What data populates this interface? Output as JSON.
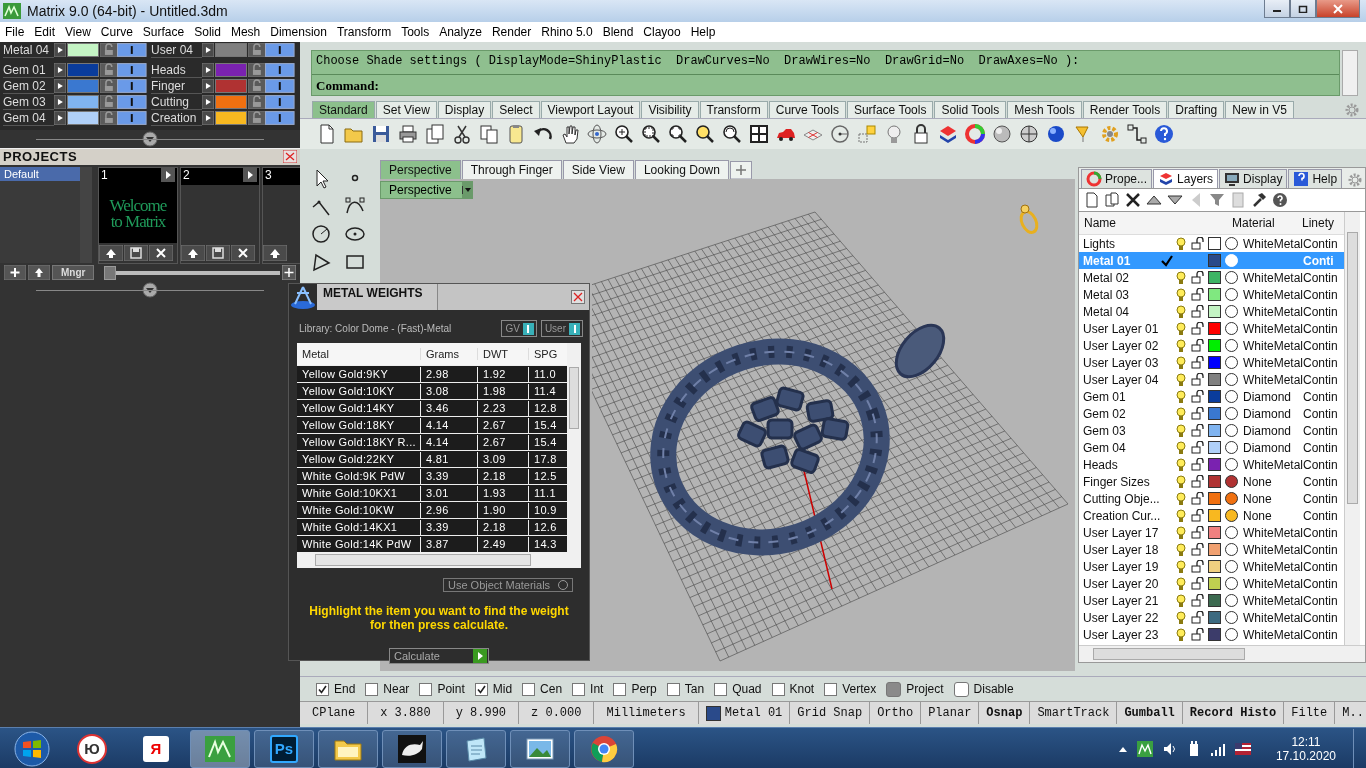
{
  "window": {
    "title": "Matrix 9.0 (64-bit) - Untitled.3dm"
  },
  "menu": [
    "File",
    "Edit",
    "View",
    "Curve",
    "Surface",
    "Solid",
    "Mesh",
    "Dimension",
    "Transform",
    "Tools",
    "Analyze",
    "Render",
    "Rhino 5.0",
    "Blend",
    "Clayoo",
    "Help"
  ],
  "layer_swatches": [
    {
      "items": [
        {
          "name": "Metal 04",
          "color": "#c4f4c4"
        },
        {
          "name": "User 04",
          "color": "#7f7f7f"
        }
      ]
    },
    {
      "items": [
        {
          "name": "Gem 01",
          "color": "#0a3c9c"
        },
        {
          "name": "Heads",
          "color": "#7a22b0"
        },
        {
          "name": "Gem 02",
          "color": "#3a78d0"
        },
        {
          "name": "Finger",
          "color": "#b03232"
        },
        {
          "name": "Gem 03",
          "color": "#80b4f0"
        },
        {
          "name": "Cutting",
          "color": "#f07010"
        },
        {
          "name": "Gem 04",
          "color": "#b0d0f8"
        },
        {
          "name": "Creation",
          "color": "#f8b820"
        }
      ]
    }
  ],
  "projects": {
    "title": "PROJECTS",
    "list": [
      {
        "label": "Default",
        "selected": true
      }
    ],
    "slots": [
      {
        "number": "1",
        "caption": "Welcome to Matrix"
      },
      {
        "number": "2"
      },
      {
        "number": "3"
      }
    ],
    "manager_button": "Mngr",
    "slider": {
      "level": 0
    }
  },
  "command": {
    "history": "Choose Shade settings ( DisplayMode=ShinyPlastic  DrawCurves=No  DrawWires=No  DrawGrid=No  DrawAxes=No ):",
    "prompt": "Command:"
  },
  "toolbar_tabs": [
    {
      "label": "Standard",
      "selected": true
    },
    {
      "label": "Set View",
      "selected": false
    },
    {
      "label": "Display",
      "selected": false
    },
    {
      "label": "Select",
      "selected": false
    },
    {
      "label": "Viewport Layout",
      "selected": false
    },
    {
      "label": "Visibility",
      "selected": false
    },
    {
      "label": "Transform",
      "selected": false
    },
    {
      "label": "Curve Tools",
      "selected": false
    },
    {
      "label": "Surface Tools",
      "selected": false
    },
    {
      "label": "Solid Tools",
      "selected": false
    },
    {
      "label": "Mesh Tools",
      "selected": false
    },
    {
      "label": "Render Tools",
      "selected": false
    },
    {
      "label": "Drafting",
      "selected": false
    },
    {
      "label": "New in V5",
      "selected": false
    }
  ],
  "viewport": {
    "tabs": [
      {
        "label": "Perspective",
        "selected": true
      },
      {
        "label": "Through Finger",
        "selected": false
      },
      {
        "label": "Side View",
        "selected": false
      },
      {
        "label": "Looking Down",
        "selected": false
      }
    ],
    "label": "Perspective"
  },
  "metal_weights": {
    "title": "METAL WEIGHTS",
    "library": "Library: Color Dome - (Fast)-Metal",
    "toggles": [
      {
        "label": "GV",
        "on": true
      },
      {
        "label": "User",
        "on": true
      }
    ],
    "columns": [
      "Metal",
      "Grams",
      "DWT",
      "SPG"
    ],
    "rows": [
      [
        "Yellow Gold:9KY",
        "2.98",
        "1.92",
        "11.0"
      ],
      [
        "Yellow Gold:10KY",
        "3.08",
        "1.98",
        "11.4"
      ],
      [
        "Yellow Gold:14KY",
        "3.46",
        "2.23",
        "12.8"
      ],
      [
        "Yellow Gold:18KY",
        "4.14",
        "2.67",
        "15.4"
      ],
      [
        "Yellow Gold:18KY R...",
        "4.14",
        "2.67",
        "15.4"
      ],
      [
        "Yellow Gold:22KY",
        "4.81",
        "3.09",
        "17.8"
      ],
      [
        "White Gold:9K PdW",
        "3.39",
        "2.18",
        "12.5"
      ],
      [
        "White Gold:10KX1",
        "3.01",
        "1.93",
        "11.1"
      ],
      [
        "White Gold:10KW",
        "2.96",
        "1.90",
        "10.9"
      ],
      [
        "White Gold:14KX1",
        "3.39",
        "2.18",
        "12.6"
      ],
      [
        "White Gold:14K PdW",
        "3.87",
        "2.49",
        "14.3"
      ]
    ],
    "option": {
      "label": "Use Object Materials",
      "on": false
    },
    "hint": "Highlight the item you want to find the weight for then press calculate.",
    "button": "Calculate"
  },
  "panel": {
    "tabs": [
      {
        "label": "Prope...",
        "selected": false
      },
      {
        "label": "Layers",
        "selected": true
      },
      {
        "label": "Display",
        "selected": false
      },
      {
        "label": "Help",
        "selected": false
      }
    ],
    "columns": [
      "Name",
      "Material",
      "Linety"
    ],
    "layers": [
      {
        "name": "Lights",
        "current": false,
        "selected": false,
        "color": "#ffffff",
        "material_filled": false,
        "material": "WhiteMetal",
        "linetype": "Contin"
      },
      {
        "name": "Metal 01",
        "current": true,
        "selected": true,
        "color": "#2a4a8a",
        "material_filled": true,
        "linetype": "Conti"
      },
      {
        "name": "Metal 02",
        "current": false,
        "selected": false,
        "color": "#3cb464",
        "material_filled": false,
        "material": "WhiteMetal",
        "linetype": "Contin"
      },
      {
        "name": "Metal 03",
        "current": false,
        "selected": false,
        "color": "#80e880",
        "material_filled": false,
        "material": "WhiteMetal",
        "linetype": "Contin"
      },
      {
        "name": "Metal 04",
        "current": false,
        "selected": false,
        "color": "#c4f4c4",
        "material_filled": false,
        "material": "WhiteMetal",
        "linetype": "Contin"
      },
      {
        "name": "User Layer 01",
        "current": false,
        "selected": false,
        "color": "#ff0000",
        "material_filled": false,
        "material": "WhiteMetal",
        "linetype": "Contin"
      },
      {
        "name": "User Layer 02",
        "current": false,
        "selected": false,
        "color": "#00ee00",
        "material_filled": false,
        "material": "WhiteMetal",
        "linetype": "Contin"
      },
      {
        "name": "User Layer 03",
        "current": false,
        "selected": false,
        "color": "#0000ff",
        "material_filled": false,
        "material": "WhiteMetal",
        "linetype": "Contin"
      },
      {
        "name": "User Layer 04",
        "current": false,
        "selected": false,
        "color": "#808080",
        "material_filled": false,
        "material": "WhiteMetal",
        "linetype": "Contin"
      },
      {
        "name": "Gem 01",
        "current": false,
        "selected": false,
        "color": "#0a3c9c",
        "material_filled": false,
        "material": "Diamond",
        "linetype": "Contin"
      },
      {
        "name": "Gem 02",
        "current": false,
        "selected": false,
        "color": "#3a78d0",
        "material_filled": false,
        "material": "Diamond",
        "linetype": "Contin"
      },
      {
        "name": "Gem 03",
        "current": false,
        "selected": false,
        "color": "#80b4f0",
        "material_filled": false,
        "material": "Diamond",
        "linetype": "Contin"
      },
      {
        "name": "Gem 04",
        "current": false,
        "selected": false,
        "color": "#b0d0f8",
        "material_filled": false,
        "material": "Diamond",
        "linetype": "Contin"
      },
      {
        "name": "Heads",
        "current": false,
        "selected": false,
        "color": "#7a22b0",
        "material_filled": false,
        "material": "WhiteMetal",
        "linetype": "Contin"
      },
      {
        "name": "Finger Sizes",
        "current": false,
        "selected": false,
        "color": "#b03232",
        "material_filled": true,
        "material": "None",
        "linetype": "Contin"
      },
      {
        "name": "Cutting Obje...",
        "current": false,
        "selected": false,
        "color": "#f07010",
        "material_filled": true,
        "material": "None",
        "linetype": "Contin"
      },
      {
        "name": "Creation Cur...",
        "current": false,
        "selected": false,
        "color": "#f8b820",
        "material_filled": true,
        "material": "None",
        "linetype": "Contin"
      },
      {
        "name": "User Layer 17",
        "current": false,
        "selected": false,
        "color": "#f08080",
        "material_filled": false,
        "material": "WhiteMetal",
        "linetype": "Contin"
      },
      {
        "name": "User Layer 18",
        "current": false,
        "selected": false,
        "color": "#f0a070",
        "material_filled": false,
        "material": "WhiteMetal",
        "linetype": "Contin"
      },
      {
        "name": "User Layer 19",
        "current": false,
        "selected": false,
        "color": "#f0d080",
        "material_filled": false,
        "material": "WhiteMetal",
        "linetype": "Contin"
      },
      {
        "name": "User Layer 20",
        "current": false,
        "selected": false,
        "color": "#c0d050",
        "material_filled": false,
        "material": "WhiteMetal",
        "linetype": "Contin"
      },
      {
        "name": "User Layer 21",
        "current": false,
        "selected": false,
        "color": "#3c6a50",
        "material_filled": false,
        "material": "WhiteMetal",
        "linetype": "Contin"
      },
      {
        "name": "User Layer 22",
        "current": false,
        "selected": false,
        "color": "#3c6a80",
        "material_filled": false,
        "material": "WhiteMetal",
        "linetype": "Contin"
      },
      {
        "name": "User Layer 23",
        "current": false,
        "selected": false,
        "color": "#3c3c6a",
        "material_filled": false,
        "material": "WhiteMetal",
        "linetype": "Contin"
      }
    ]
  },
  "osnap": [
    {
      "kind": "checkbox",
      "label": "End",
      "checked": true
    },
    {
      "kind": "checkbox",
      "label": "Near",
      "checked": false
    },
    {
      "kind": "checkbox",
      "label": "Point",
      "checked": false
    },
    {
      "kind": "checkbox",
      "label": "Mid",
      "checked": true
    },
    {
      "kind": "checkbox",
      "label": "Cen",
      "checked": false
    },
    {
      "kind": "checkbox",
      "label": "Int",
      "checked": false
    },
    {
      "kind": "checkbox",
      "label": "Perp",
      "checked": false
    },
    {
      "kind": "checkbox",
      "label": "Tan",
      "checked": false
    },
    {
      "kind": "checkbox",
      "label": "Quad",
      "checked": false
    },
    {
      "kind": "checkbox",
      "label": "Knot",
      "checked": false
    },
    {
      "kind": "checkbox",
      "label": "Vertex",
      "checked": false
    },
    {
      "kind": "toggle",
      "label": "Project",
      "checked": true
    },
    {
      "kind": "toggle",
      "label": "Disable",
      "checked": false
    }
  ],
  "status_bar": [
    {
      "kind": "text",
      "label": "CPlane"
    },
    {
      "kind": "text",
      "label": "x 3.880"
    },
    {
      "kind": "text",
      "label": "y 8.990"
    },
    {
      "kind": "text",
      "label": "z 0.000"
    },
    {
      "kind": "text",
      "label": "Millimeters"
    },
    {
      "kind": "layer",
      "label": "Metal 01",
      "color": "#2a4a8a"
    },
    {
      "kind": "toggle",
      "label": "Grid Snap",
      "on": false
    },
    {
      "kind": "toggle",
      "label": "Ortho",
      "on": false
    },
    {
      "kind": "toggle",
      "label": "Planar",
      "on": false
    },
    {
      "kind": "toggle",
      "label": "Osnap",
      "on": true
    },
    {
      "kind": "toggle",
      "label": "SmartTrack",
      "on": false
    },
    {
      "kind": "toggle",
      "label": "Gumball",
      "on": true
    },
    {
      "kind": "toggle",
      "label": "Record Histo",
      "on": true
    },
    {
      "kind": "toggle",
      "label": "Filte",
      "on": false
    },
    {
      "kind": "toggle",
      "label": "M..",
      "on": false
    }
  ],
  "taskbar": {
    "items": [
      {
        "kind": "disc",
        "label": "Ю",
        "running": false,
        "selected": false
      },
      {
        "kind": "tile",
        "label": "Я",
        "running": false,
        "selected": false
      },
      {
        "kind": "matrix",
        "running": true,
        "selected": true
      },
      {
        "kind": "ps",
        "label": "Ps",
        "running": true,
        "selected": false
      },
      {
        "kind": "folder",
        "running": true,
        "selected": false
      },
      {
        "kind": "rhino",
        "running": true,
        "selected": false
      },
      {
        "kind": "pad",
        "running": true,
        "selected": false
      },
      {
        "kind": "photo",
        "running": true,
        "selected": false
      },
      {
        "kind": "globe",
        "running": true,
        "selected": false
      }
    ],
    "time": "12:11",
    "date": "17.10.2020"
  }
}
